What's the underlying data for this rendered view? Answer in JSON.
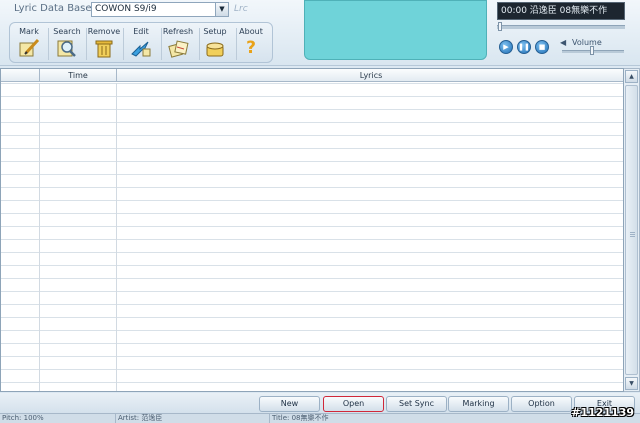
{
  "toolbar": {
    "db_label": "Lyric Data Base",
    "device": "COWON S9/i9",
    "logo": "Lrc",
    "tools": [
      {
        "label": "Mark",
        "icon": "pencil-paper-icon"
      },
      {
        "label": "Search",
        "icon": "magnifier-icon"
      },
      {
        "label": "Remove",
        "icon": "trash-icon"
      },
      {
        "label": "Edit",
        "icon": "edit-arrow-icon"
      },
      {
        "label": "Refresh",
        "icon": "refresh-documents-icon"
      },
      {
        "label": "Setup",
        "icon": "setup-box-icon"
      },
      {
        "label": "About",
        "icon": "question-icon"
      }
    ]
  },
  "player": {
    "song": "00:00 沿逸臣 08無樂不作",
    "volume_label": "Volume",
    "progress": 0.02,
    "volume": 0.5
  },
  "grid": {
    "columns": [
      "",
      "Time",
      "Lyrics"
    ]
  },
  "buttons": [
    "New",
    "Open",
    "Set Sync",
    "Marking",
    "Option",
    "Exit"
  ],
  "status": {
    "seg1": "Pitch: 100%",
    "seg2": "Artist: 范逸臣",
    "seg3": "Title: 08無樂不作"
  },
  "watermark": "#1121139",
  "colors": {
    "display_panel": "#6fd3d9",
    "selected_border": "#d0283a"
  }
}
